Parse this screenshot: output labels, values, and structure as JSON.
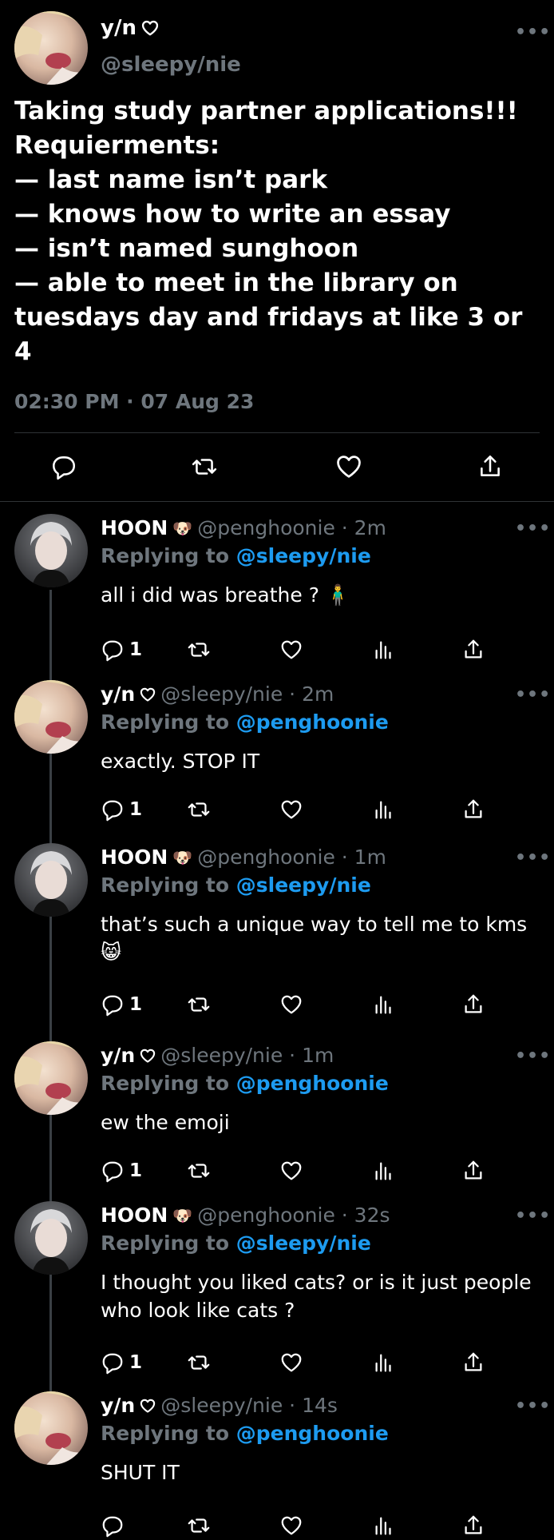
{
  "main_tweet": {
    "name": "y/n",
    "handle": "@sleepy/nie",
    "text": "Taking study partner applications!!! Requierments:\n— last name isn’t park\n— knows how to write an essay\n— isn’t named sunghoon\n— able to meet in the library on tuesdays day and fridays at like 3 or 4",
    "timestamp": "02:30 PM · 07 Aug 23",
    "icons": [
      "reply-icon",
      "retweet-icon",
      "like-icon",
      "share-icon"
    ]
  },
  "replies": [
    {
      "name": "HOON",
      "emoji": "🐶",
      "handle": "@penghoonie · 2m",
      "replying_prefix": "Replying to ",
      "replying_to": "@sleepy/nie",
      "text": "all i did was breathe ? 🧍‍♂️",
      "reply_count": "1",
      "author": "hoon"
    },
    {
      "name": "y/n",
      "emoji": "♡",
      "handle": "@sleepy/nie · 2m",
      "replying_prefix": "Replying to ",
      "replying_to": "@penghoonie",
      "text": "exactly. STOP IT",
      "reply_count": "1",
      "author": "yn"
    },
    {
      "name": "HOON",
      "emoji": "🐶",
      "handle": "@penghoonie · 1m",
      "replying_prefix": "Replying to ",
      "replying_to": "@sleepy/nie",
      "text": "that’s such a unique way to tell me to kms 😸",
      "reply_count": "1",
      "author": "hoon"
    },
    {
      "name": "y/n",
      "emoji": "♡",
      "handle": "@sleepy/nie · 1m",
      "replying_prefix": "Replying to ",
      "replying_to": "@penghoonie",
      "text": "ew the emoji",
      "reply_count": "1",
      "author": "yn"
    },
    {
      "name": "HOON",
      "emoji": "🐶",
      "handle": "@penghoonie · 32s",
      "replying_prefix": "Replying to ",
      "replying_to": "@sleepy/nie",
      "text": "I thought you liked cats? or is it just people who look like cats ?",
      "reply_count": "1",
      "author": "hoon"
    },
    {
      "name": "y/n",
      "emoji": "♡",
      "handle": "@sleepy/nie · 14s",
      "replying_prefix": "Replying to ",
      "replying_to": "@penghoonie",
      "text": "SHUT IT",
      "reply_count": "",
      "author": "yn"
    }
  ],
  "colors": {
    "background": "#000000",
    "text": "#ffffff",
    "muted": "#6e767d",
    "link": "#1d9bf0",
    "divider": "#2f3336"
  }
}
